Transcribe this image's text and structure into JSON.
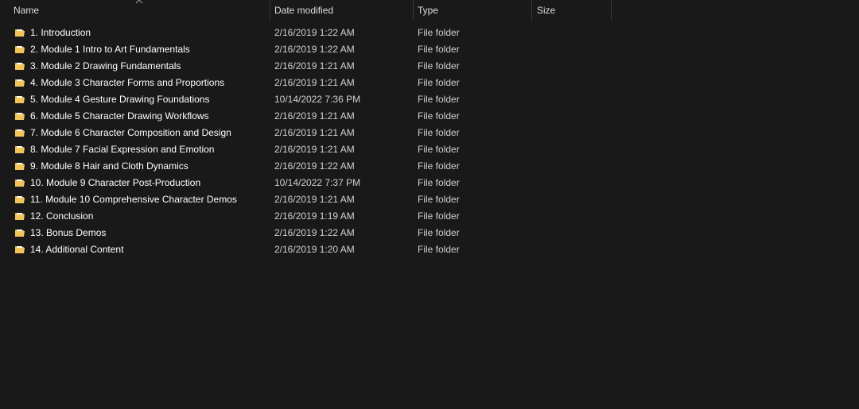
{
  "columns": {
    "name": "Name",
    "date": "Date modified",
    "type": "Type",
    "size": "Size"
  },
  "icons": {
    "folder": "folder-icon",
    "sort": "sort-ascending-icon"
  },
  "colors": {
    "background": "#191919",
    "folder": "#f2c55c"
  },
  "rows": [
    {
      "name": "1. Introduction",
      "date": "2/16/2019 1:22 AM",
      "type": "File folder"
    },
    {
      "name": "2. Module 1 Intro to Art Fundamentals",
      "date": "2/16/2019 1:22 AM",
      "type": "File folder"
    },
    {
      "name": "3. Module 2 Drawing Fundamentals",
      "date": "2/16/2019 1:21 AM",
      "type": "File folder"
    },
    {
      "name": "4. Module 3 Character Forms and Proportions",
      "date": "2/16/2019 1:21 AM",
      "type": "File folder"
    },
    {
      "name": "5. Module 4 Gesture Drawing Foundations",
      "date": "10/14/2022 7:36 PM",
      "type": "File folder"
    },
    {
      "name": "6. Module 5 Character Drawing Workflows",
      "date": "2/16/2019 1:21 AM",
      "type": "File folder"
    },
    {
      "name": "7. Module 6 Character Composition and Design",
      "date": "2/16/2019 1:21 AM",
      "type": "File folder"
    },
    {
      "name": "8. Module 7 Facial Expression and Emotion",
      "date": "2/16/2019 1:21 AM",
      "type": "File folder"
    },
    {
      "name": "9. Module 8 Hair and Cloth Dynamics",
      "date": "2/16/2019 1:22 AM",
      "type": "File folder"
    },
    {
      "name": "10. Module 9 Character Post-Production",
      "date": "10/14/2022 7:37 PM",
      "type": "File folder"
    },
    {
      "name": "11. Module 10 Comprehensive Character Demos",
      "date": "2/16/2019 1:21 AM",
      "type": "File folder"
    },
    {
      "name": "12. Conclusion",
      "date": "2/16/2019 1:19 AM",
      "type": "File folder"
    },
    {
      "name": "13. Bonus Demos",
      "date": "2/16/2019 1:22 AM",
      "type": "File folder"
    },
    {
      "name": "14. Additional Content",
      "date": "2/16/2019 1:20 AM",
      "type": "File folder"
    }
  ]
}
